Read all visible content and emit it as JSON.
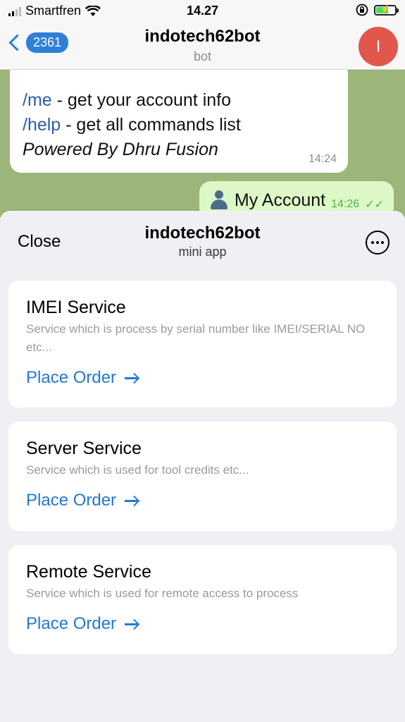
{
  "status_bar": {
    "carrier": "Smartfren",
    "time": "14.27"
  },
  "chat_header": {
    "back_count": "2361",
    "title": "indotech62bot",
    "subtitle": "bot",
    "avatar_letter": "I"
  },
  "messages": {
    "incoming": {
      "me_cmd": "/me",
      "me_desc": " - get your account info",
      "help_cmd": "/help",
      "help_desc": " - get all commands list",
      "powered": "Powered By Dhru Fusion",
      "time": "14:24"
    },
    "outgoing": {
      "text": "My Account",
      "time": "14:26"
    }
  },
  "mini_app": {
    "close_label": "Close",
    "title": "indotech62bot",
    "subtitle": "mini app",
    "services": [
      {
        "title": "IMEI Service",
        "description": "Service which is process by serial number like IMEI/SERIAL NO etc...",
        "action": "Place Order"
      },
      {
        "title": "Server Service",
        "description": "Service which is used for tool credits etc...",
        "action": "Place Order"
      },
      {
        "title": "Remote Service",
        "description": "Service which is used for remote access to process",
        "action": "Place Order"
      }
    ]
  },
  "colors": {
    "accent": "#2378d4",
    "avatar": "#e2574c",
    "chat_background": "#9cb57b",
    "outgoing_bubble": "#dcf8c6"
  }
}
